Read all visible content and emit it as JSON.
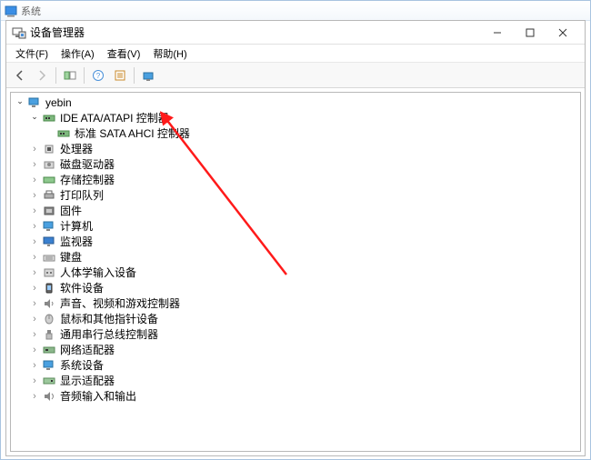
{
  "outer_window": {
    "title": "系统"
  },
  "inner_window": {
    "title": "设备管理器"
  },
  "menu": {
    "file": "文件(F)",
    "action": "操作(A)",
    "view": "查看(V)",
    "help": "帮助(H)"
  },
  "tree": {
    "root": {
      "label": "yebin"
    },
    "ide_cat": {
      "label": "IDE ATA/ATAPI 控制器"
    },
    "ide_child": {
      "label": "标准 SATA AHCI 控制器"
    },
    "cpu": {
      "label": "处理器"
    },
    "disk": {
      "label": "磁盘驱动器"
    },
    "storage": {
      "label": "存储控制器"
    },
    "printq": {
      "label": "打印队列"
    },
    "firmware": {
      "label": "固件"
    },
    "computer": {
      "label": "计算机"
    },
    "monitor": {
      "label": "监视器"
    },
    "keyboard": {
      "label": "键盘"
    },
    "hid": {
      "label": "人体学输入设备"
    },
    "software": {
      "label": "软件设备"
    },
    "audio_game": {
      "label": "声音、视频和游戏控制器"
    },
    "mouse": {
      "label": "鼠标和其他指针设备"
    },
    "usb": {
      "label": "通用串行总线控制器"
    },
    "network": {
      "label": "网络适配器"
    },
    "system": {
      "label": "系统设备"
    },
    "display": {
      "label": "显示适配器"
    },
    "audio_io": {
      "label": "音频输入和输出"
    }
  }
}
